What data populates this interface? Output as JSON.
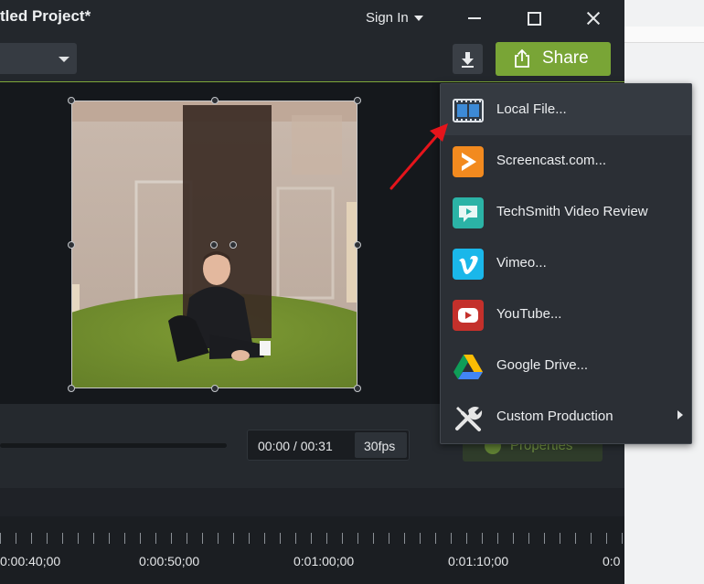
{
  "window": {
    "title": "tled Project*",
    "sign_in": "Sign In"
  },
  "toolbar": {
    "share_label": "Share"
  },
  "player": {
    "time": "00:00 / 00:31",
    "fps": "30fps",
    "properties_label": "Properties"
  },
  "timeline": {
    "labels": [
      "0:00:40;00",
      "0:00:50;00",
      "0:01:00;00",
      "0:01:10;00",
      "0:0"
    ]
  },
  "share_menu": {
    "items": [
      {
        "label": "Local File...",
        "icon": "film-icon",
        "color": "#3b4553"
      },
      {
        "label": "Screencast.com...",
        "icon": "screencast-icon",
        "color": "#f28a1f"
      },
      {
        "label": "TechSmith Video Review",
        "icon": "techsmith-review-icon",
        "color": "#2bb3a6"
      },
      {
        "label": "Vimeo...",
        "icon": "vimeo-icon",
        "color": "#1ab7ea"
      },
      {
        "label": "YouTube...",
        "icon": "youtube-icon",
        "color": "#e52d27"
      },
      {
        "label": "Google Drive...",
        "icon": "google-drive-icon",
        "color": "#fbbc04"
      },
      {
        "label": "Custom Production",
        "icon": "tools-icon",
        "color": "#e6e6e6"
      }
    ]
  },
  "colors": {
    "accent": "#79a536",
    "annotation_arrow": "#e5141b"
  }
}
